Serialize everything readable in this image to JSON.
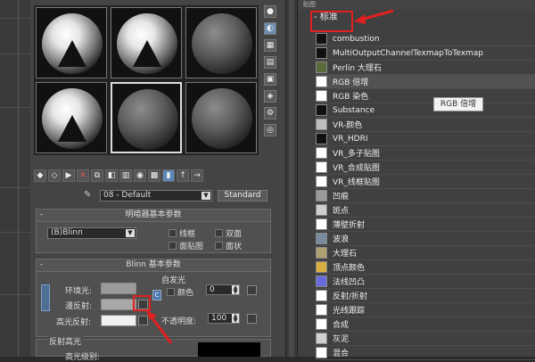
{
  "editor": {
    "material_name": "08 - Default",
    "type_button": "Standard",
    "shader_rollout": {
      "title": "明暗器基本参数",
      "shader": "(B)Blinn",
      "checkboxes": [
        "线框",
        "双面",
        "面贴图",
        "面状"
      ]
    },
    "blinn_rollout": {
      "title": "Blinn 基本参数",
      "self_illum_group": "自发光",
      "color_label": "颜色",
      "color_value": "0",
      "ambient_label": "环境光:",
      "diffuse_label": "漫反射:",
      "specular_label": "高光反射:",
      "opacity_label": "不透明度:",
      "opacity_value": "100",
      "lock_label": "C"
    },
    "spec_rollout": {
      "title": "反射高光",
      "level_label": "高光级别:"
    }
  },
  "browser": {
    "top_label": "贴图",
    "group_label": "- 标准",
    "items": [
      {
        "label": "combustion",
        "thumb": "#111111"
      },
      {
        "label": "MultiOutputChannelTexmapToTexmap",
        "thumb": "#111111"
      },
      {
        "label": "Perlin 大理石",
        "thumb": "#5a6a3a"
      },
      {
        "label": "RGB 倍增",
        "thumb": "#ffffff"
      },
      {
        "label": "RGB 染色",
        "thumb": "#ffffff"
      },
      {
        "label": "Substance",
        "thumb": "#111111"
      },
      {
        "label": "VR-颜色",
        "thumb": "#bdbdbd"
      },
      {
        "label": "VR_HDRI",
        "thumb": "#111111"
      },
      {
        "label": "VR_多子贴图",
        "thumb": "#ffffff"
      },
      {
        "label": "VR_合成贴图",
        "thumb": "#ffffff"
      },
      {
        "label": "VR_线框贴图",
        "thumb": "#ffffff"
      },
      {
        "label": "凹痕",
        "thumb": "#9a9a9a"
      },
      {
        "label": "斑点",
        "thumb": "#cfcfcf"
      },
      {
        "label": "薄壁折射",
        "thumb": "#ffffff"
      },
      {
        "label": "波浪",
        "thumb": "#7a8aa0"
      },
      {
        "label": "大理石",
        "thumb": "#b0a070"
      },
      {
        "label": "顶点颜色",
        "thumb": "#d9b040"
      },
      {
        "label": "法线凹凸",
        "thumb": "#6a6ae0"
      },
      {
        "label": "反射/折射",
        "thumb": "#ffffff"
      },
      {
        "label": "光线跟踪",
        "thumb": "#ffffff"
      },
      {
        "label": "合成",
        "thumb": "#ffffff"
      },
      {
        "label": "灰泥",
        "thumb": "#d0d0d0"
      },
      {
        "label": "混合",
        "thumb": "#ffffff"
      }
    ],
    "tooltip": "RGB 倍增"
  },
  "colors": {
    "annotation_red": "#e12020",
    "ambient_swatch": "#9a9a9a",
    "diffuse_swatch": "#a8a8a8",
    "specular_swatch": "#f0f0f0"
  }
}
